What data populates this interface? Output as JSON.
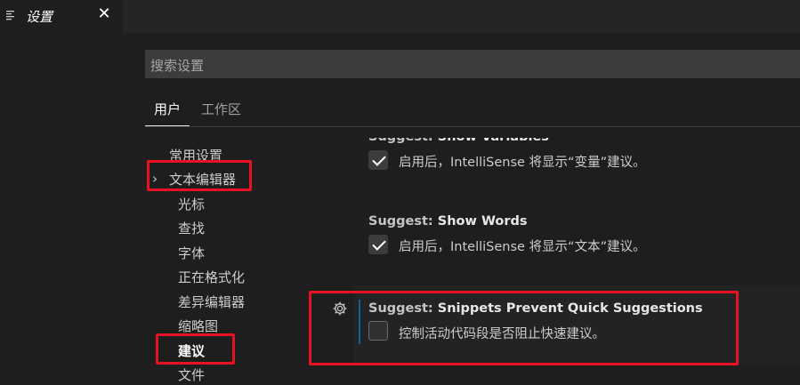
{
  "tab": {
    "title": "设置",
    "icon": "settings-editor-icon",
    "close": "✕"
  },
  "search": {
    "placeholder": "搜索设置"
  },
  "scope_tabs": [
    {
      "label": "用户",
      "active": true
    },
    {
      "label": "工作区",
      "active": false
    }
  ],
  "toc": [
    {
      "label": "常用设置"
    },
    {
      "label": "文本编辑器",
      "expanded": true
    },
    {
      "label": "光标"
    },
    {
      "label": "查找"
    },
    {
      "label": "字体"
    },
    {
      "label": "正在格式化"
    },
    {
      "label": "差异编辑器"
    },
    {
      "label": "缩略图"
    },
    {
      "label": "建议",
      "active": true
    },
    {
      "label": "文件"
    }
  ],
  "settings": [
    {
      "category": "Suggest: ",
      "name": "Show Variables",
      "description": "启用后，IntelliSense 将显示“变量”建议。",
      "checked": true
    },
    {
      "category": "Suggest: ",
      "name": "Show Words",
      "description": "启用后，IntelliSense 将显示“文本”建议。",
      "checked": true
    },
    {
      "category": "Suggest: ",
      "name": "Snippets Prevent Quick Suggestions",
      "description": "控制活动代码段是否阻止快速建议。",
      "checked": false
    }
  ],
  "colors": {
    "annotation": "#e81224",
    "accent": "#0e639c"
  }
}
